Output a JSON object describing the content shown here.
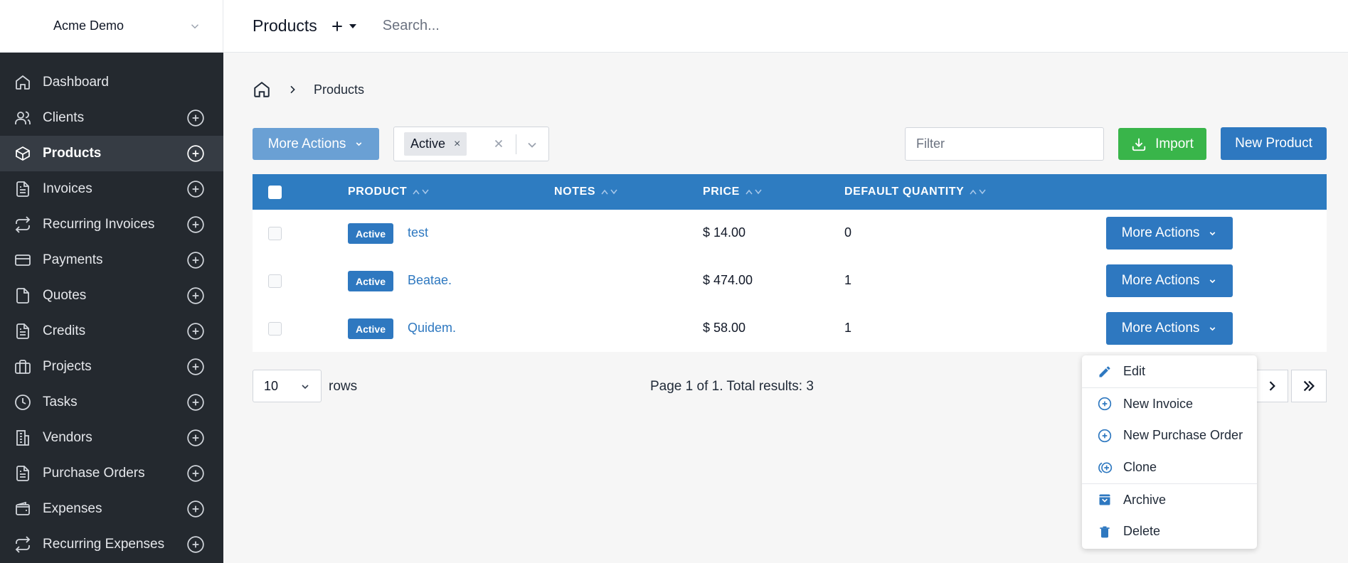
{
  "company": {
    "name": "Acme Demo"
  },
  "sidebar": {
    "items": [
      {
        "label": "Dashboard",
        "icon": "home-icon",
        "add": false,
        "active": false
      },
      {
        "label": "Clients",
        "icon": "users-icon",
        "add": true,
        "active": false
      },
      {
        "label": "Products",
        "icon": "box-icon",
        "add": true,
        "active": true
      },
      {
        "label": "Invoices",
        "icon": "file-text-icon",
        "add": true,
        "active": false
      },
      {
        "label": "Recurring Invoices",
        "icon": "repeat-icon",
        "add": true,
        "active": false
      },
      {
        "label": "Payments",
        "icon": "credit-card-icon",
        "add": true,
        "active": false
      },
      {
        "label": "Quotes",
        "icon": "file-icon",
        "add": true,
        "active": false
      },
      {
        "label": "Credits",
        "icon": "file-text-icon",
        "add": true,
        "active": false
      },
      {
        "label": "Projects",
        "icon": "briefcase-icon",
        "add": true,
        "active": false
      },
      {
        "label": "Tasks",
        "icon": "clock-icon",
        "add": true,
        "active": false
      },
      {
        "label": "Vendors",
        "icon": "building-icon",
        "add": true,
        "active": false
      },
      {
        "label": "Purchase Orders",
        "icon": "file-text-icon",
        "add": true,
        "active": false
      },
      {
        "label": "Expenses",
        "icon": "wallet-icon",
        "add": true,
        "active": false
      },
      {
        "label": "Recurring Expenses",
        "icon": "repeat-icon",
        "add": true,
        "active": false
      }
    ]
  },
  "header": {
    "title": "Products",
    "search_placeholder": "Search..."
  },
  "breadcrumb": {
    "current": "Products"
  },
  "toolbar": {
    "more_actions": "More Actions",
    "status_chip": "Active",
    "chip_remove": "×",
    "filter_placeholder": "Filter",
    "import": "Import",
    "new_product": "New Product"
  },
  "table": {
    "columns": [
      "PRODUCT",
      "NOTES",
      "PRICE",
      "DEFAULT QUANTITY"
    ],
    "rows": [
      {
        "status": "Active",
        "product": "test",
        "notes": "",
        "price": "$ 14.00",
        "quantity": "0",
        "action": "More Actions"
      },
      {
        "status": "Active",
        "product": "Beatae.",
        "notes": "",
        "price": "$ 474.00",
        "quantity": "1",
        "action": "More Actions"
      },
      {
        "status": "Active",
        "product": "Quidem.",
        "notes": "",
        "price": "$ 58.00",
        "quantity": "1",
        "action": "More Actions"
      }
    ]
  },
  "pagination": {
    "rows_per_page": "10",
    "rows_label": "rows",
    "info": "Page 1 of 1. Total results: 3"
  },
  "dropdown": {
    "items": [
      {
        "label": "Edit",
        "icon": "pencil-icon"
      },
      {
        "label": "New Invoice",
        "icon": "plus-circle-icon"
      },
      {
        "label": "New Purchase Order",
        "icon": "plus-circle-icon"
      },
      {
        "label": "Clone",
        "icon": "clone-icon"
      },
      {
        "label": "Archive",
        "icon": "archive-icon"
      },
      {
        "label": "Delete",
        "icon": "trash-icon"
      }
    ]
  },
  "colors": {
    "primary": "#2e78c0",
    "header": "#2e7cc1",
    "success": "#39b54a",
    "sidebar": "#24292f"
  }
}
